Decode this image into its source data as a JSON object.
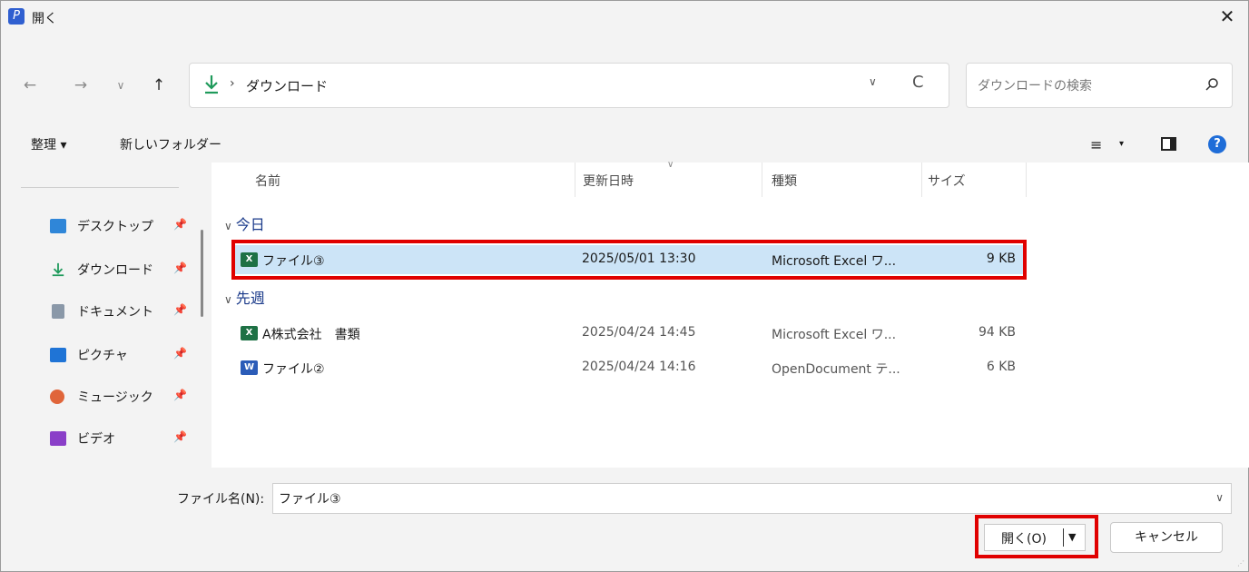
{
  "window": {
    "title": "開く",
    "close_glyph": "✕"
  },
  "nav": {
    "back": "←",
    "forward": "→",
    "recent": "∨",
    "up": "↑"
  },
  "address": {
    "separator": "›",
    "location": "ダウンロード",
    "chevron": "∨",
    "refresh": "C"
  },
  "search": {
    "placeholder": "ダウンロードの検索"
  },
  "commands": {
    "organize": "整理 ▾",
    "new_folder": "新しいフォルダー",
    "view_glyph": "≡",
    "view_caret": "▾",
    "help": "?"
  },
  "sidebar": {
    "items": [
      {
        "label": "デスクトップ",
        "icon": "desktop-icon",
        "color": "#2f86d8"
      },
      {
        "label": "ダウンロード",
        "icon": "download-icon",
        "color": "#1f9a5b"
      },
      {
        "label": "ドキュメント",
        "icon": "documents-icon",
        "color": "#8a98a8"
      },
      {
        "label": "ピクチャ",
        "icon": "pictures-icon",
        "color": "#1f74d6"
      },
      {
        "label": "ミュージック",
        "icon": "music-icon",
        "color": "#e0653a"
      },
      {
        "label": "ビデオ",
        "icon": "videos-icon",
        "color": "#8a3fc8"
      }
    ]
  },
  "columns": {
    "name": "名前",
    "modified": "更新日時",
    "type": "種類",
    "size": "サイズ"
  },
  "groups": [
    {
      "title": "今日",
      "files": [
        {
          "name": "ファイル③",
          "modified": "2025/05/01 13:30",
          "type": "Microsoft Excel ワ...",
          "size": "9 KB",
          "icon": "excel-file-icon",
          "selected": true
        }
      ]
    },
    {
      "title": "先週",
      "files": [
        {
          "name": "A株式会社　書類",
          "modified": "2025/04/24 14:45",
          "type": "Microsoft Excel ワ...",
          "size": "94 KB",
          "icon": "excel-file-icon",
          "selected": false
        },
        {
          "name": "ファイル②",
          "modified": "2025/04/24 14:16",
          "type": "OpenDocument テ...",
          "size": "6 KB",
          "icon": "word-file-icon",
          "selected": false
        }
      ]
    }
  ],
  "footer": {
    "filename_label": "ファイル名(N):",
    "filename_value": "ファイル③",
    "open_button": "開く(O)",
    "cancel_button": "キャンセル"
  },
  "colors": {
    "highlight": "#e00000",
    "selected_row": "#cce4f7",
    "accent": "#1f6dd8"
  }
}
